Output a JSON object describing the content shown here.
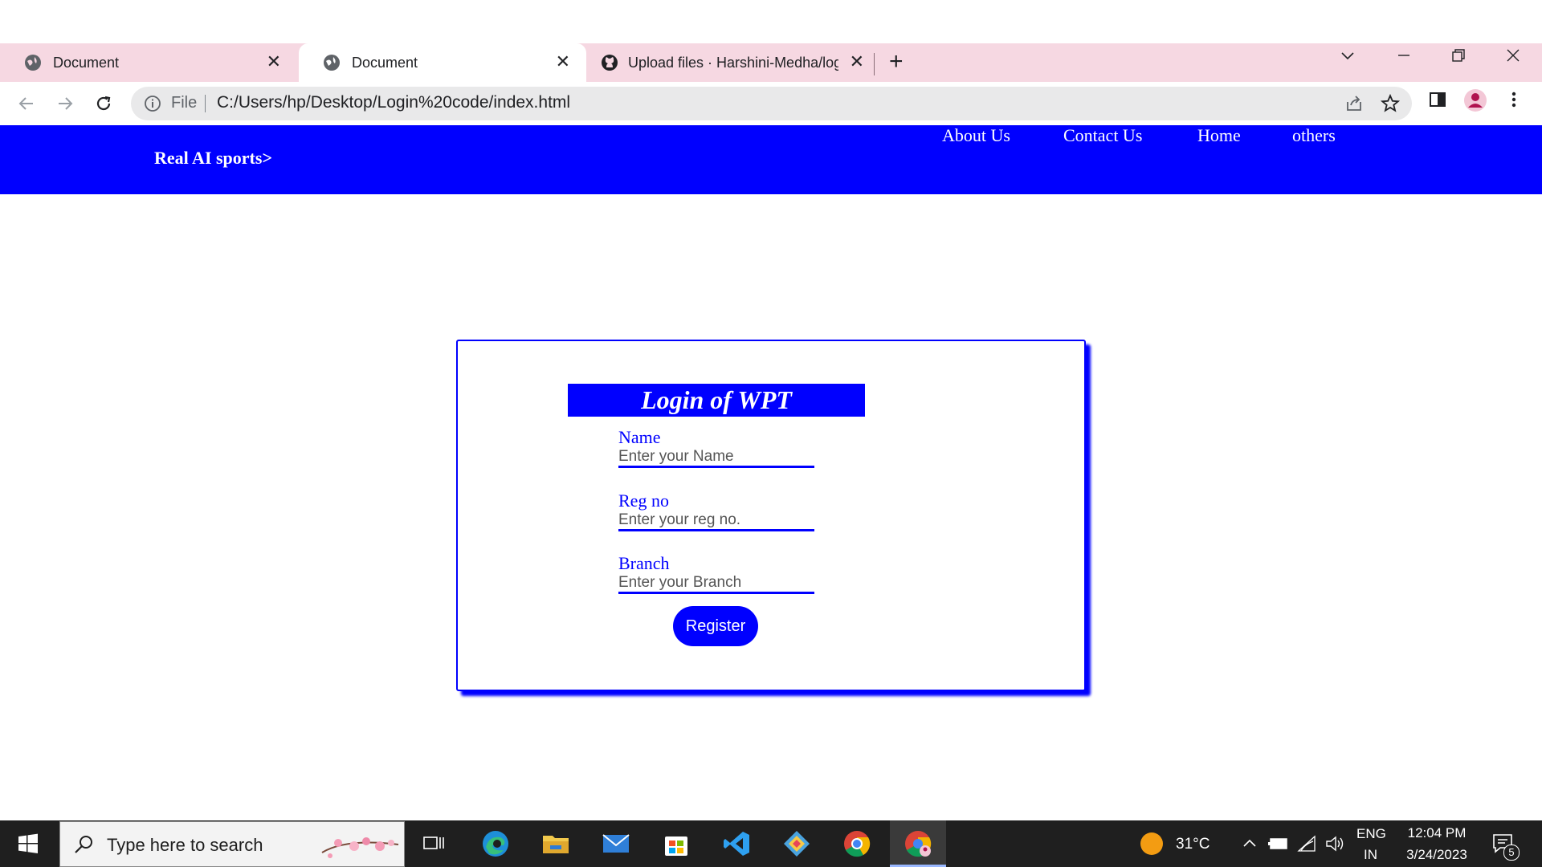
{
  "browser": {
    "tabs": [
      {
        "title": "Document",
        "active": false
      },
      {
        "title": "Document",
        "active": true
      },
      {
        "title": "Upload files · Harshini-Medha/log",
        "active": false
      }
    ],
    "address": {
      "scheme_label": "File",
      "url": "C:/Users/hp/Desktop/Login%20code/index.html"
    }
  },
  "page": {
    "brand": "Real AI sports>",
    "nav_links": [
      "About Us",
      "Contact Us",
      "Home",
      "others"
    ],
    "form": {
      "title": "Login of WPT",
      "fields": [
        {
          "label": "Name",
          "placeholder": "Enter your Name"
        },
        {
          "label": "Reg no",
          "placeholder": "Enter your reg no."
        },
        {
          "label": "Branch",
          "placeholder": "Enter your Branch"
        }
      ],
      "submit_label": "Register"
    },
    "colors": {
      "accent": "#0000ff",
      "tabstrip": "#f6d8e2"
    }
  },
  "taskbar": {
    "search_placeholder": "Type here to search",
    "temperature": "31°C",
    "lang_line1": "ENG",
    "lang_line2": "IN",
    "time": "12:04 PM",
    "date": "3/24/2023",
    "notification_count": "5"
  }
}
